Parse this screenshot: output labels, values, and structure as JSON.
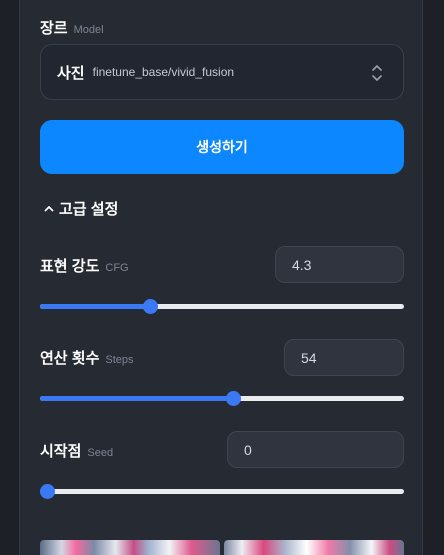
{
  "model_section": {
    "label": "장르",
    "label_sub": "Model",
    "select": {
      "name": "사진",
      "path": "finetune_base/vivid_fusion"
    }
  },
  "generate_button": {
    "label": "생성하기"
  },
  "advanced": {
    "label": "고급 설정",
    "expanded": true
  },
  "cfg": {
    "label": "표현 강도",
    "label_sub": "CFG",
    "value": "4.3",
    "slider_fraction": 0.295
  },
  "steps": {
    "label": "연산 횟수",
    "label_sub": "Steps",
    "value": "54",
    "slider_fraction": 0.53
  },
  "seed": {
    "label": "시작점",
    "label_sub": "Seed",
    "value": "0",
    "slider_fraction": 0.0
  },
  "icons": {
    "select_arrows": "chevron-up-down-icon",
    "advanced_toggle": "chevron-up-icon"
  },
  "colors": {
    "accent": "#0d87ff",
    "slider_fill": "#3b78f5",
    "panel_bg": "#262a33"
  }
}
